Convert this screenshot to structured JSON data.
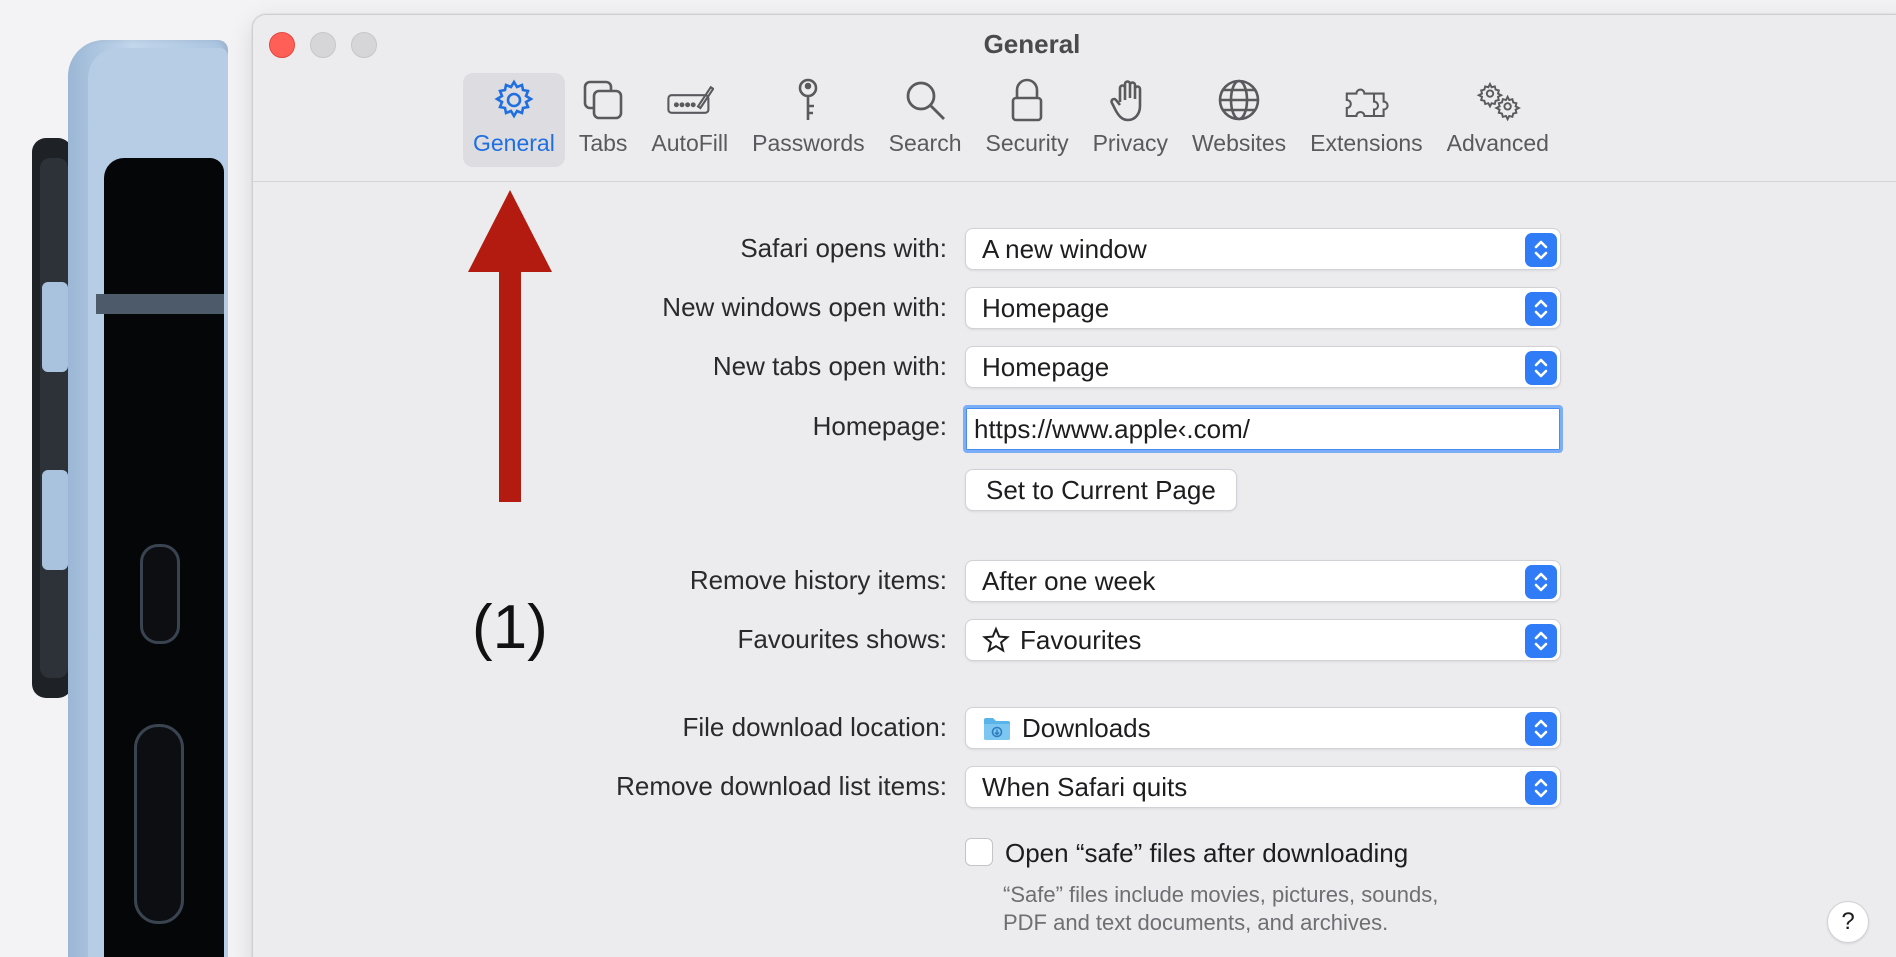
{
  "window": {
    "title": "General"
  },
  "toolbar": {
    "tabs": [
      {
        "label": "General",
        "icon": "gear-icon",
        "active": true
      },
      {
        "label": "Tabs",
        "icon": "tabs-icon"
      },
      {
        "label": "AutoFill",
        "icon": "autofill-icon"
      },
      {
        "label": "Passwords",
        "icon": "key-icon"
      },
      {
        "label": "Search",
        "icon": "magnifier-icon"
      },
      {
        "label": "Security",
        "icon": "lock-icon"
      },
      {
        "label": "Privacy",
        "icon": "hand-icon"
      },
      {
        "label": "Websites",
        "icon": "globe-icon"
      },
      {
        "label": "Extensions",
        "icon": "puzzle-icon"
      },
      {
        "label": "Advanced",
        "icon": "gears-icon"
      }
    ]
  },
  "settings": {
    "safari_opens_with": {
      "label": "Safari opens with:",
      "value": "A new window"
    },
    "new_windows": {
      "label": "New windows open with:",
      "value": "Homepage"
    },
    "new_tabs": {
      "label": "New tabs open with:",
      "value": "Homepage"
    },
    "homepage": {
      "label": "Homepage:",
      "value": "https://www.apple‹.com/"
    },
    "set_current_page": "Set to Current Page",
    "remove_history": {
      "label": "Remove history items:",
      "value": "After one week"
    },
    "favourites_shows": {
      "label": "Favourites shows:",
      "value": "Favourites",
      "icon": "star-icon"
    },
    "download_location": {
      "label": "File download location:",
      "value": "Downloads",
      "icon": "folder-icon"
    },
    "remove_download_list": {
      "label": "Remove download list items:",
      "value": "When Safari quits"
    },
    "open_safe_files": {
      "label": "Open “safe” files after downloading",
      "checked": false
    },
    "safe_note_line1": "“Safe” files include movies, pictures, sounds,",
    "safe_note_line2": "PDF and text documents, and archives.",
    "help": "?"
  },
  "annotation": {
    "step": "(1)",
    "arrow_color": "#b31b10"
  },
  "colors": {
    "accent": "#2f7cf6",
    "close": "#ff5f57"
  }
}
